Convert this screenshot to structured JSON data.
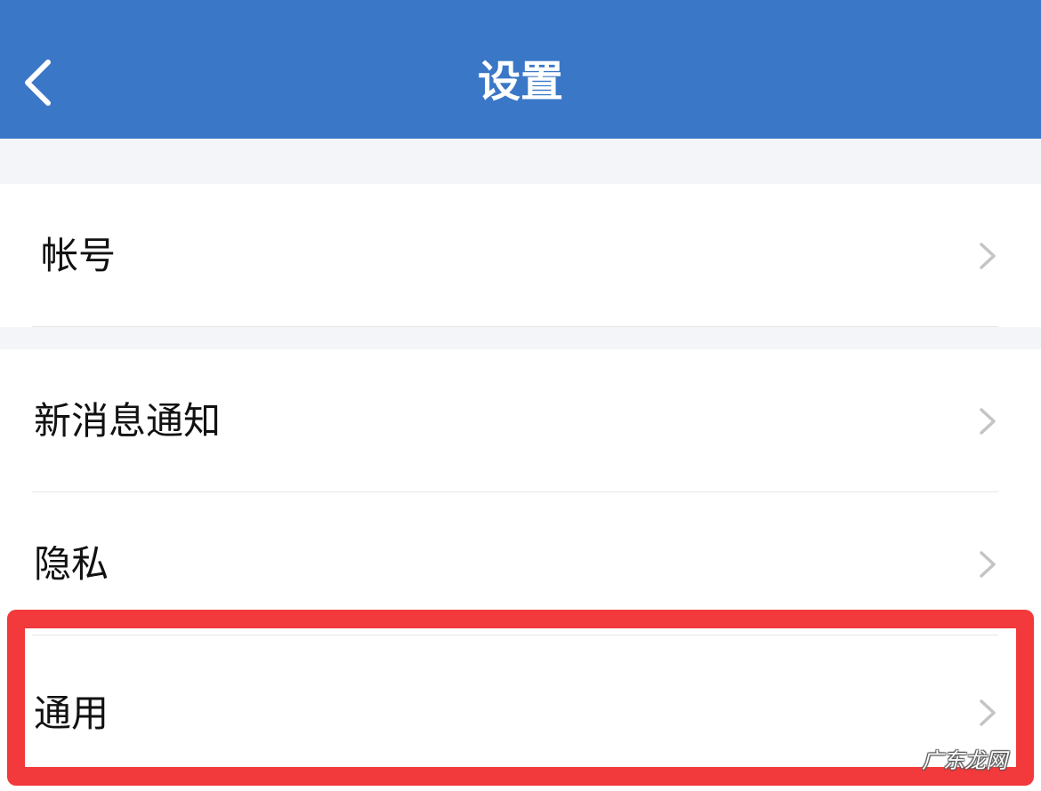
{
  "header": {
    "title": "设置",
    "back_icon": "chevron-left-icon",
    "background_color": "#3a77c7"
  },
  "sections": [
    {
      "items": [
        {
          "label": "帐号",
          "icon": "chevron-right-icon"
        }
      ]
    },
    {
      "items": [
        {
          "label": "新消息通知",
          "icon": "chevron-right-icon"
        },
        {
          "label": "隐私",
          "icon": "chevron-right-icon"
        },
        {
          "label": "通用",
          "icon": "chevron-right-icon",
          "highlighted": true
        }
      ]
    }
  ],
  "highlight_color": "#f2393b",
  "watermark": "广东龙网"
}
